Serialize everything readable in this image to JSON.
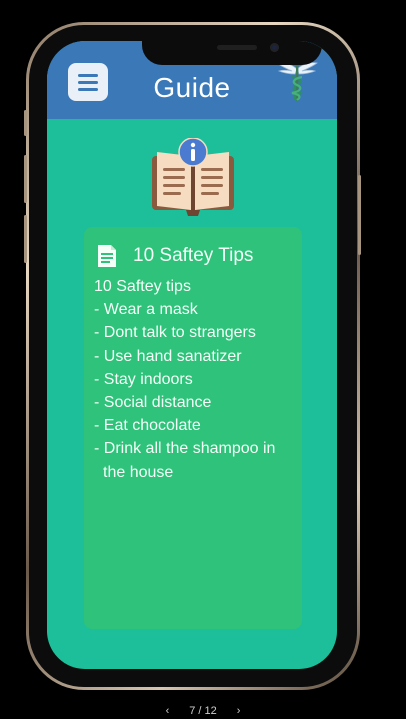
{
  "app_bar": {
    "title": "Guide",
    "menu_icon": "hamburger-icon",
    "logo_icon": "caduceus-icon"
  },
  "hero": {
    "icon": "book-info-icon"
  },
  "card": {
    "icon": "document-icon",
    "title": "10 Saftey Tips",
    "heading": "10 Saftey tips",
    "tips": [
      "- Wear a mask",
      "- Dont talk to strangers",
      "- Use hand sanatizer",
      "- Stay indoors",
      "- Social distance",
      "- Eat chocolate",
      "- Drink all the shampoo in the house"
    ]
  },
  "pager": {
    "prev": "‹",
    "label": "7 / 12",
    "next": "›"
  },
  "colors": {
    "app_bar": "#3a78b8",
    "screen_bg": "#1dbf9a",
    "card_bg": "#2ec27a"
  }
}
